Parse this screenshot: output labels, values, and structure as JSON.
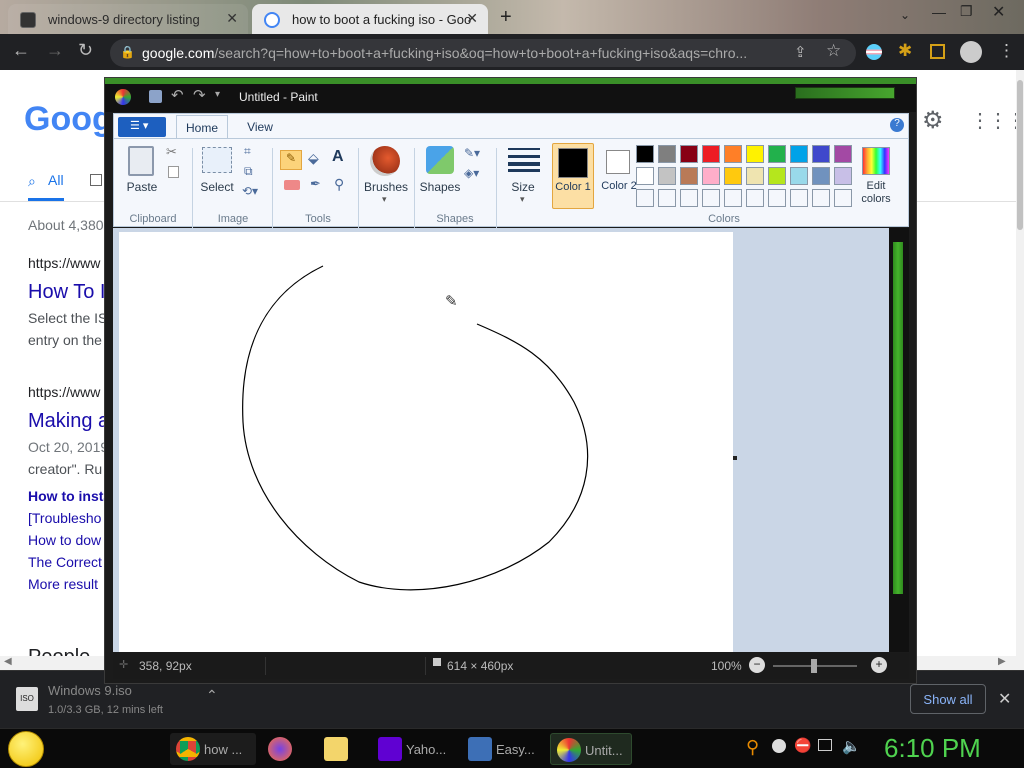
{
  "browser": {
    "tabs": [
      {
        "title": "windows-9 directory listing",
        "active": false
      },
      {
        "title": "how to boot a fucking iso - Goo",
        "active": true
      }
    ],
    "url_main": "google.com",
    "url_rest": "/search?q=how+to+boot+a+fucking+iso&oq=how+to+boot+a+fucking+iso&aqs=chro..."
  },
  "google": {
    "logo": "Google",
    "tab_all": "All",
    "result_count": "About 4,380",
    "results": [
      {
        "url": "https://www",
        "title": "How To I",
        "snippet1": "Select the IS",
        "snippet2": "entry on the"
      },
      {
        "url": "https://www",
        "title": "Making a",
        "snippet1": "Oct 20, 2019",
        "snippet2": "creator\". Ru"
      }
    ],
    "links": [
      "How to insta",
      "[Troublesho",
      "How to dow",
      "The Correct",
      "More result"
    ],
    "people": "People"
  },
  "paint": {
    "title": "Untitled - Paint",
    "tabs": [
      "Home",
      "View"
    ],
    "groups": {
      "clipboard": "Clipboard",
      "image": "Image",
      "tools": "Tools",
      "shapes": "Shapes",
      "colors": "Colors"
    },
    "buttons": {
      "paste": "Paste",
      "select": "Select",
      "brushes": "Brushes",
      "shapes": "Shapes",
      "size": "Size",
      "color1": "Color 1",
      "color2": "Color 2",
      "edit_colors": "Edit colors"
    },
    "palette_row1": [
      "#000000",
      "#7f7f7f",
      "#880015",
      "#ed1c24",
      "#ff7f27",
      "#fff200",
      "#22b14c",
      "#00a2e8",
      "#3f48cc",
      "#a349a4"
    ],
    "palette_row2": [
      "#ffffff",
      "#c3c3c3",
      "#b97a57",
      "#ffaec9",
      "#ffc90e",
      "#efe4b0",
      "#b5e61d",
      "#99d9ea",
      "#7092be",
      "#c8bfe7"
    ],
    "status": {
      "cursor_pos": "358, 92px",
      "canvas_size": "614 × 460px",
      "zoom": "100%"
    }
  },
  "download": {
    "filename": "Windows 9.iso",
    "progress": "1.0/3.3 GB, 12 mins left",
    "show_all": "Show all"
  },
  "taskbar": {
    "items": [
      {
        "label": "how ...",
        "icon": "chrome-icon"
      },
      {
        "label": "",
        "icon": "firefox-icon"
      },
      {
        "label": "",
        "icon": "folder-icon"
      },
      {
        "label": "Yaho...",
        "icon": "yahoo-icon"
      },
      {
        "label": "Easy...",
        "icon": "computer-icon"
      },
      {
        "label": "Untit...",
        "icon": "paint-icon"
      }
    ],
    "clock": "6:10 PM"
  }
}
